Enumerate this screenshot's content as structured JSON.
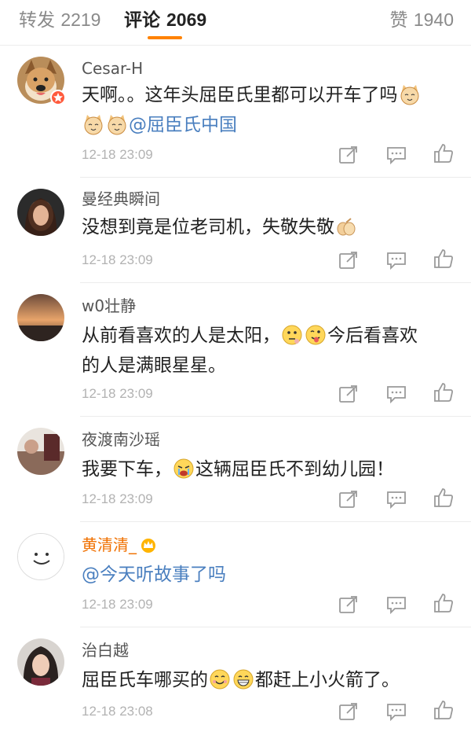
{
  "tabs": {
    "repost": {
      "label": "转发",
      "count": "2219"
    },
    "comments": {
      "label": "评论",
      "count": "2069"
    },
    "likes": {
      "label": "赞",
      "count": "1940"
    }
  },
  "colors": {
    "accent": "#ff8200",
    "mention": "#4a7fbf",
    "vip_name": "#f07000",
    "time": "#b2b2b2"
  },
  "comments": [
    {
      "user": "Cesar-H",
      "text_a": "天啊。。这年头屈臣氏里都可以开车了吗",
      "mention": "@屈臣氏中国",
      "time": "12-18 23:09",
      "emojis": [
        "cat-emoji",
        "cat-emoji",
        "cat-emoji"
      ]
    },
    {
      "user": "曼经典瞬间",
      "text_a": "没想到竟是位老司机，失敬失敬",
      "time": "12-18 23:09",
      "emojis": [
        "fist-salute-emoji"
      ]
    },
    {
      "user": "w0壮静",
      "text_a": "从前看喜欢的人是太阳，",
      "text_b": "今后看喜欢",
      "text_c": "的人是满眼星星。",
      "time": "12-18 23:09",
      "emojis": [
        "thinking-emoji",
        "tongue-emoji"
      ]
    },
    {
      "user": "夜渡南沙瑶",
      "text_a": "我要下车，",
      "text_b": "这辆屈臣氏不到幼儿园！",
      "time": "12-18 23:09",
      "emojis": [
        "crying-emoji"
      ]
    },
    {
      "user": "黄清清_",
      "mention": "@今天听故事了吗",
      "time": "12-18 23:09",
      "emojis": []
    },
    {
      "user": "治白越",
      "text_a": "屈臣氏车哪买的",
      "text_b": "都赶上小火箭了。",
      "time": "12-18 23:08",
      "emojis": [
        "smile-emoji",
        "grin-emoji"
      ]
    }
  ],
  "icons": {
    "share": "share-icon",
    "reply": "comment-icon",
    "like": "thumbs-up-icon"
  }
}
